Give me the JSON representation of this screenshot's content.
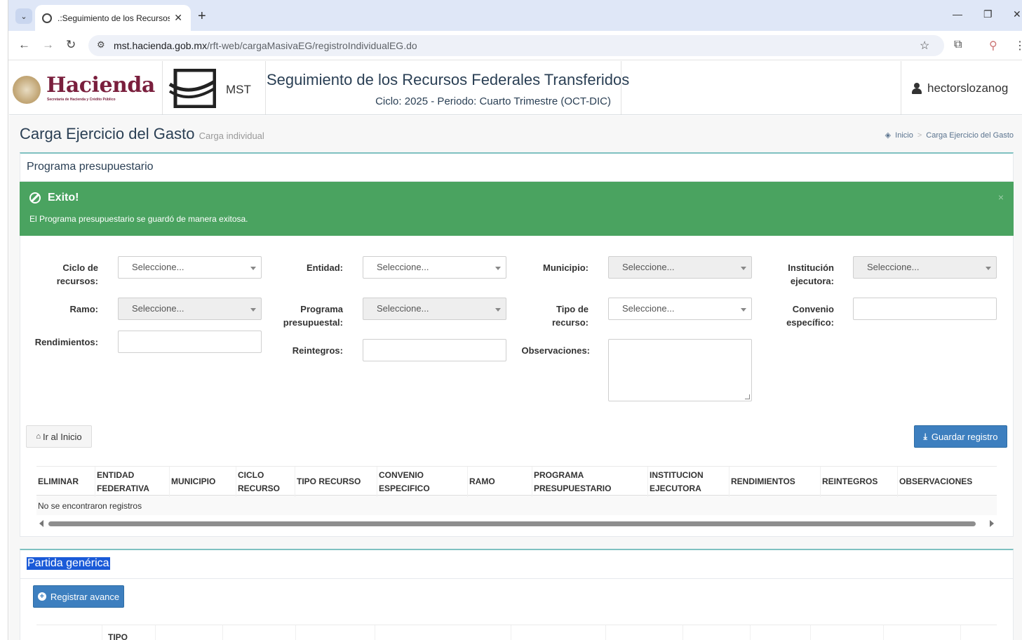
{
  "browser": {
    "tab_title": ".:Seguimiento de los Recursos F",
    "url_host": "mst.hacienda.gob.mx",
    "url_path": "/rft-web/cargaMasivaEG/registroIndividualEG.do"
  },
  "header": {
    "logo_text": "Hacienda",
    "logo_sub": "Secretaría de Hacienda y Crédito Público",
    "mst_text": "MST",
    "title": "Seguimiento de los Recursos Federales Transferidos",
    "subtitle": "Ciclo: 2025 - Periodo: Cuarto Trimestre (OCT-DIC)",
    "user": "hectorslozanog"
  },
  "page": {
    "title": "Carga Ejercicio del Gasto",
    "subtitle": "Carga individual",
    "breadcrumb_home": "Inicio",
    "breadcrumb_sep": ">",
    "breadcrumb_current": "Carga Ejercicio del Gasto"
  },
  "panel1": {
    "title": "Programa presupuestario",
    "alert_title": "Exito!",
    "alert_message": "El Programa presupuestario se guardó de manera exitosa.",
    "alert_close": "×"
  },
  "form": {
    "placeholder": "Seleccione...",
    "ciclo_label_1": "Ciclo de",
    "ciclo_label_2": "recursos:",
    "entidad_label": "Entidad:",
    "municipio_label": "Municipio:",
    "institucion_label_1": "Institución",
    "institucion_label_2": "ejecutora:",
    "ramo_label": "Ramo:",
    "programa_label_1": "Programa",
    "programa_label_2": "presupuestal:",
    "tipo_label_1": "Tipo de",
    "tipo_label_2": "recurso:",
    "convenio_label_1": "Convenio",
    "convenio_label_2": "específico:",
    "rendimientos_label": "Rendimientos:",
    "reintegros_label": "Reintegros:",
    "observaciones_label": "Observaciones:"
  },
  "buttons": {
    "home": "Ir al Inicio",
    "save": "Guardar registro",
    "register": "Registrar avance"
  },
  "table": {
    "headers": [
      [
        "ELIMINAR"
      ],
      [
        "ENTIDAD",
        "FEDERATIVA"
      ],
      [
        "MUNICIPIO"
      ],
      [
        "CICLO",
        "RECURSO"
      ],
      [
        "TIPO RECURSO"
      ],
      [
        "CONVENIO",
        "ESPECIFICO"
      ],
      [
        "RAMO"
      ],
      [
        "PROGRAMA",
        "PRESUPUESTARIO"
      ],
      [
        "INSTITUCION",
        "EJECUTORA"
      ],
      [
        "RENDIMIENTOS"
      ],
      [
        "REINTEGROS"
      ],
      [
        "OBSERVACIONES"
      ]
    ],
    "empty_message": "No se encontraron registros"
  },
  "panel2": {
    "title": "Partida genérica",
    "table_first_header": "TIPO"
  }
}
